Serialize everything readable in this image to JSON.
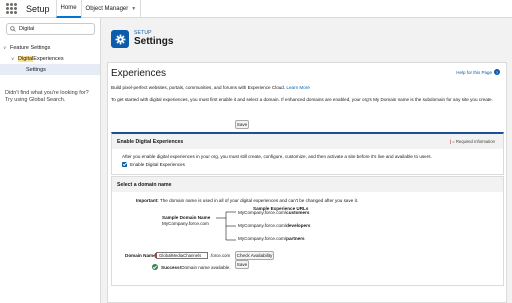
{
  "topnav": {
    "app_name": "Setup",
    "tabs": [
      {
        "label": "Home"
      },
      {
        "label": "Object Manager"
      }
    ]
  },
  "sidebar": {
    "search_value": "Digital",
    "tree": {
      "group": "Feature Settings",
      "subgroup_prefix": "Digital",
      "subgroup_suffix": " Experiences",
      "item": "Settings"
    },
    "not_found": {
      "line1": "Didn't find what you're looking for?",
      "line2": "Try using Global Search."
    }
  },
  "header": {
    "breadcrumb": "SETUP",
    "title": "Settings"
  },
  "page": {
    "heading": "Experiences",
    "help_link": "Help for this Page",
    "intro_text": "Build pixel-perfect websites, portals, communities, and forums with Experience Cloud. ",
    "intro_link": "Learn More",
    "get_started": "To get started with digital experiences, you must first enable it and select a domain. If enhanced domains are enabled, your org's My Domain name is the subdomain for any site you create.",
    "save_top": "Save",
    "save_bottom": "Save"
  },
  "enable_section": {
    "title": "Enable Digital Experiences",
    "required_info": "= Required Information",
    "description": "After you enable digital experiences in your org, you must still create, configure, customize, and then activate a site before it's live and available to users.",
    "checkbox_label": "Enable Digital Experiences",
    "checkbox_checked": true
  },
  "domain_section": {
    "title": "Select a domain name",
    "important_label": "Important:",
    "important_text": " The domain name is used in all of your digital experiences and can't be changed after you save it.",
    "sample_urls_title": "Sample Experience URLs",
    "sample_domain_title": "Sample Domain Name",
    "sample_domain_value": "MyCompany.force.com",
    "urls": [
      {
        "prefix": "MyCompany.force.com/",
        "path": "customers"
      },
      {
        "prefix": "MyCompany.force.com/",
        "path": "developers"
      },
      {
        "prefix": "MyCompany.force.com/",
        "path": "partners"
      }
    ],
    "domain_name_label": "Domain Name",
    "domain_input_value": "GlobalMediaChannels",
    "domain_suffix": ".force.com",
    "check_button": "Check Availability",
    "success_bold": "Success!",
    "success_text": " Domain name available."
  },
  "colors": {
    "brand": "#0b5cab",
    "required": "#c23934",
    "success": "#2e844a",
    "highlight": "#fce08c"
  }
}
